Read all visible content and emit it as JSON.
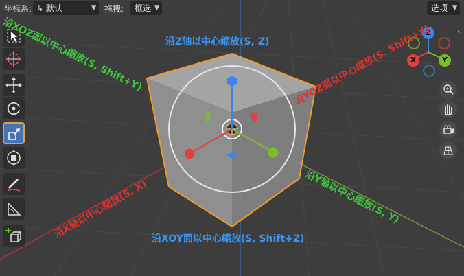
{
  "header": {
    "orientation_label": "坐标系:",
    "orientation_value": "默认",
    "drag_label": "拖拽:",
    "drag_value": "框选",
    "options_label": "选项"
  },
  "toolbar": {
    "tools": [
      "select-box",
      "cursor",
      "move",
      "rotate",
      "scale",
      "transform",
      "annotate",
      "measure",
      "add-cube"
    ],
    "active_tool": "scale"
  },
  "gizmo": {
    "z": "Z",
    "x": "X",
    "y": "Y",
    "colors": {
      "x": "#e0413f",
      "y": "#7cbd30",
      "z": "#3a86e8"
    }
  },
  "annotations": {
    "z_axis": "沿Z轴以中心缩放(S, Z)",
    "xoz_plane": "沿XOZ面以中心缩放(S, Shift+Y)",
    "yoz_plane": "沿YOZ面以中心缩放(S, Shift+X)",
    "x_axis": "沿X轴以中心缩放(S, X)",
    "y_axis": "沿Y轴以中心缩放(S, Y)",
    "xoy_plane": "沿XOY面以中心缩放(S, Shift+Z)"
  },
  "colors": {
    "viewport_bg": "#3d3d3d",
    "selection_outline": "#f29a2e",
    "active_tool": "#4772b3"
  }
}
